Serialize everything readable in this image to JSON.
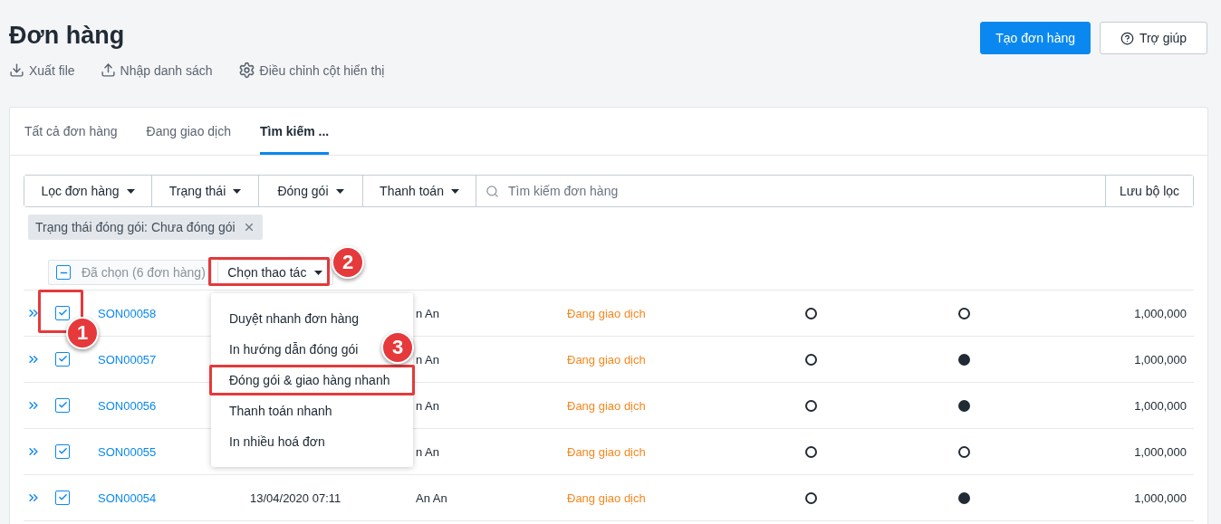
{
  "page": {
    "title": "Đơn hàng",
    "actions": [
      {
        "kind": "download",
        "label": "Xuất file"
      },
      {
        "kind": "upload",
        "label": "Nhập danh sách"
      },
      {
        "kind": "settings",
        "label": "Điều chỉnh cột hiển thị"
      }
    ],
    "buttons": [
      {
        "kind": "primary",
        "label": "Tạo đơn hàng"
      },
      {
        "kind": "help",
        "label": "Trợ giúp"
      }
    ]
  },
  "tabs": [
    {
      "label": "Tất cả đơn hàng",
      "selected": false
    },
    {
      "label": "Đang giao dịch",
      "selected": false
    },
    {
      "label": "Tìm kiếm ...",
      "selected": true
    }
  ],
  "filters": {
    "dropdowns": [
      "Lọc đơn hàng",
      "Trạng thái",
      "Đóng gói",
      "Thanh toán"
    ],
    "search": {
      "placeholder": "Tìm kiếm đơn hàng"
    },
    "save_button": "Lưu bộ lọc"
  },
  "active_filters": [
    {
      "label": "Trạng thái đóng gói: Chưa đóng gói"
    }
  ],
  "bulk": {
    "partial": true,
    "selected_text": "Đã chọn (6 đơn hàng)",
    "action_button": "Chọn thao tác"
  },
  "action_menu": {
    "items": [
      {
        "label": "Duyệt nhanh đơn hàng",
        "highlighted": false
      },
      {
        "label": "In hướng dẫn đóng gói",
        "highlighted": false
      },
      {
        "label": "Đóng gói & giao hàng nhanh",
        "highlighted": true
      },
      {
        "label": "Thanh toán nhanh",
        "highlighted": false
      },
      {
        "label": "In nhiều hoá đơn",
        "highlighted": false
      }
    ]
  },
  "rows": [
    {
      "selected": true,
      "order": "SON00058",
      "customer": "n An",
      "status": "Đang giao dịch",
      "column_7_filled": false,
      "column_8_filled": false,
      "amount": "1,000,000"
    },
    {
      "selected": true,
      "order": "SON00057",
      "customer": "n An",
      "status": "Đang giao dịch",
      "column_7_filled": false,
      "column_8_filled": true,
      "amount": "1,000,000"
    },
    {
      "selected": true,
      "order": "SON00056",
      "customer": "n An",
      "status": "Đang giao dịch",
      "column_7_filled": false,
      "column_8_filled": true,
      "amount": "1,000,000"
    },
    {
      "selected": true,
      "order": "SON00055",
      "customer": "n An",
      "status": "Đang giao dịch",
      "column_7_filled": false,
      "column_8_filled": false,
      "amount": "1,000,000"
    },
    {
      "selected": true,
      "order": "SON00054",
      "date": "13/04/2020 07:11",
      "customer": "An An",
      "status": "Đang giao dịch",
      "column_7_filled": false,
      "column_8_filled": true,
      "amount": "1,000,000"
    }
  ],
  "callouts": [
    {
      "number": "1"
    },
    {
      "number": "2"
    },
    {
      "number": "3"
    }
  ]
}
